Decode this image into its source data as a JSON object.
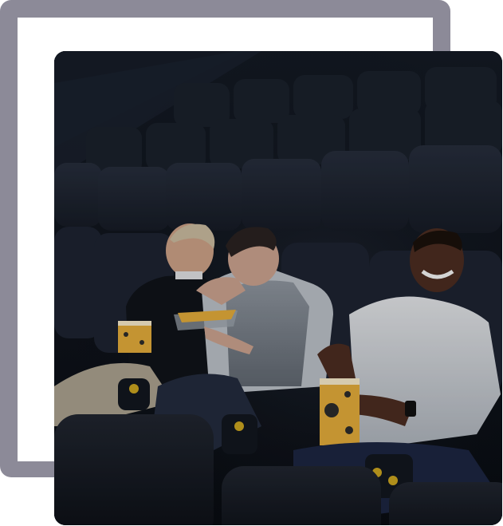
{
  "image": {
    "alt": "",
    "scene": "cinema-audience",
    "colors": {
      "frame": "#8c8a98",
      "frame_inner": "#ffffff",
      "theater_dark": "#0e1219",
      "seat": "#1c2230",
      "popcorn_box": "#e0a93a"
    }
  }
}
